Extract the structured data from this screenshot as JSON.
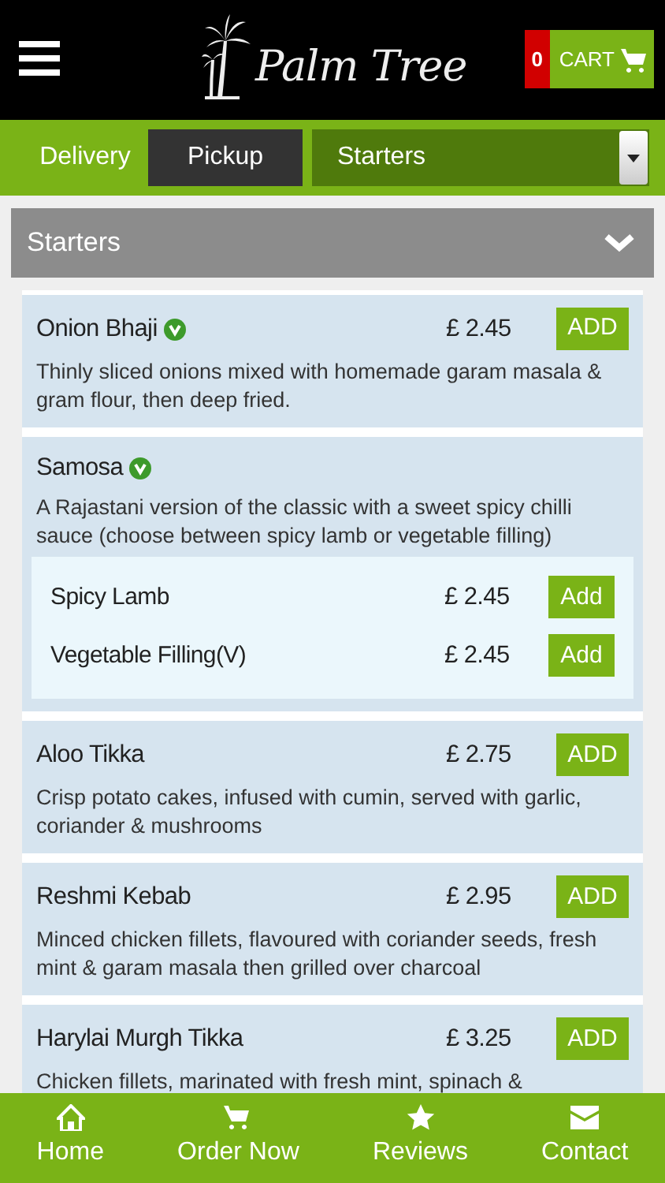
{
  "header": {
    "logo_text": "Palm Tree",
    "cart": {
      "count": "0",
      "label": "CART"
    }
  },
  "order_types": [
    {
      "label": "Delivery",
      "selected": false
    },
    {
      "label": "Pickup",
      "selected": true
    }
  ],
  "category_select": {
    "value": "Starters"
  },
  "section": {
    "title": "Starters",
    "expanded": true
  },
  "items": [
    {
      "kind": "item",
      "name": "Onion Bhaji",
      "vegetarian": true,
      "price": "£ 2.45",
      "button": "ADD",
      "description": "Thinly sliced onions mixed with homemade garam masala & gram flour, then deep fried."
    },
    {
      "kind": "options",
      "name": "Samosa",
      "vegetarian": true,
      "description": "A Rajastani version of the classic with a sweet spicy chilli sauce (choose between spicy lamb or vegetable filling)",
      "options": [
        {
          "name": "Spicy Lamb",
          "price": "£ 2.45",
          "button": "Add"
        },
        {
          "name": "Vegetable Filling(V)",
          "price": "£ 2.45",
          "button": "Add"
        }
      ]
    },
    {
      "kind": "item",
      "name": "Aloo Tikka",
      "vegetarian": false,
      "price": "£ 2.75",
      "button": "ADD",
      "description": "Crisp potato cakes, infused with cumin, served with garlic, coriander & mushrooms"
    },
    {
      "kind": "item",
      "name": "Reshmi Kebab",
      "vegetarian": false,
      "price": "£ 2.95",
      "button": "ADD",
      "description": "Minced chicken fillets, flavoured with coriander seeds, fresh mint & garam masala then grilled over charcoal"
    },
    {
      "kind": "item",
      "name": "Harylai Murgh Tikka",
      "vegetarian": false,
      "price": "£ 3.25",
      "button": "ADD",
      "description": "Chicken fillets, marinated with fresh mint, spinach &"
    }
  ],
  "bottom_nav": [
    {
      "kind": "home",
      "label": "Home"
    },
    {
      "kind": "cart",
      "label": "Order Now"
    },
    {
      "kind": "star",
      "label": "Reviews"
    },
    {
      "kind": "mail",
      "label": "Contact"
    }
  ]
}
